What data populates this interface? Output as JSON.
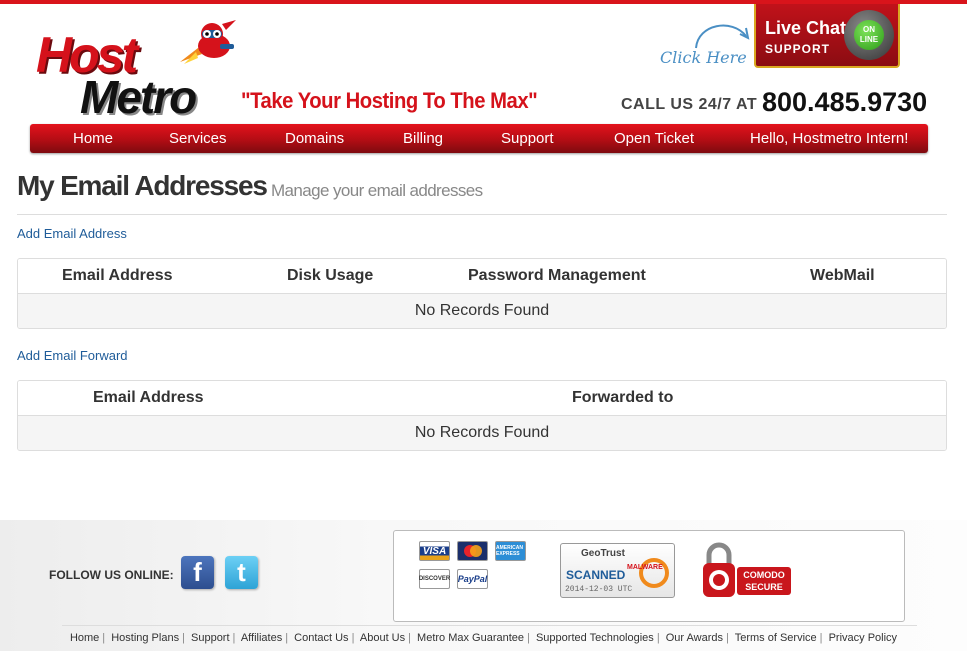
{
  "brand": {
    "logo_word_1": "Host",
    "logo_word_2": "Metro",
    "tagline": "\"Take Your Hosting To The Max\"",
    "accent": "#d5121b"
  },
  "live_chat": {
    "cta": "Click Here",
    "title": "Live Chat",
    "subtitle": "SUPPORT",
    "status_top": "ON",
    "status_bottom": "LINE"
  },
  "contact": {
    "call_label": "CALL US 24/7 AT",
    "phone": "800.485.9730"
  },
  "nav": {
    "items": [
      {
        "label": "Home"
      },
      {
        "label": "Services"
      },
      {
        "label": "Domains"
      },
      {
        "label": "Billing"
      },
      {
        "label": "Support"
      },
      {
        "label": "Open Ticket"
      },
      {
        "label": "Hello, Hostmetro Intern!"
      }
    ]
  },
  "page": {
    "title": "My Email Addresses",
    "subtitle": "Manage your email addresses"
  },
  "email_section": {
    "add_link": "Add Email Address",
    "columns": [
      "Email Address",
      "Disk Usage",
      "Password Management",
      "WebMail"
    ],
    "empty_text": "No Records Found"
  },
  "forward_section": {
    "add_link": "Add Email Forward",
    "columns": [
      "Email Address",
      "Forwarded to"
    ],
    "empty_text": "No Records Found"
  },
  "footer": {
    "follow_label": "FOLLOW US ONLINE:",
    "social": [
      {
        "name": "facebook",
        "glyph": "f"
      },
      {
        "name": "twitter",
        "glyph": "t"
      }
    ],
    "cards": {
      "visa": "VISA",
      "amex": "AMERICAN EXPRESS",
      "discover": "DISCOVER",
      "paypal": "PayPal"
    },
    "geotrust": {
      "brand": "GeoTrust",
      "scanned": "SCANNED",
      "malware": "MALWARE",
      "date": "2014-12-03 UTC"
    },
    "comodo": {
      "line1": "COMODO",
      "line2": "SECURE"
    },
    "links": [
      "Home",
      "Hosting Plans",
      "Support",
      "Affiliates",
      "Contact Us",
      "About Us",
      "Metro Max Guarantee",
      "Supported Technologies",
      "Our Awards",
      "Terms of Service",
      "Privacy Policy"
    ]
  }
}
